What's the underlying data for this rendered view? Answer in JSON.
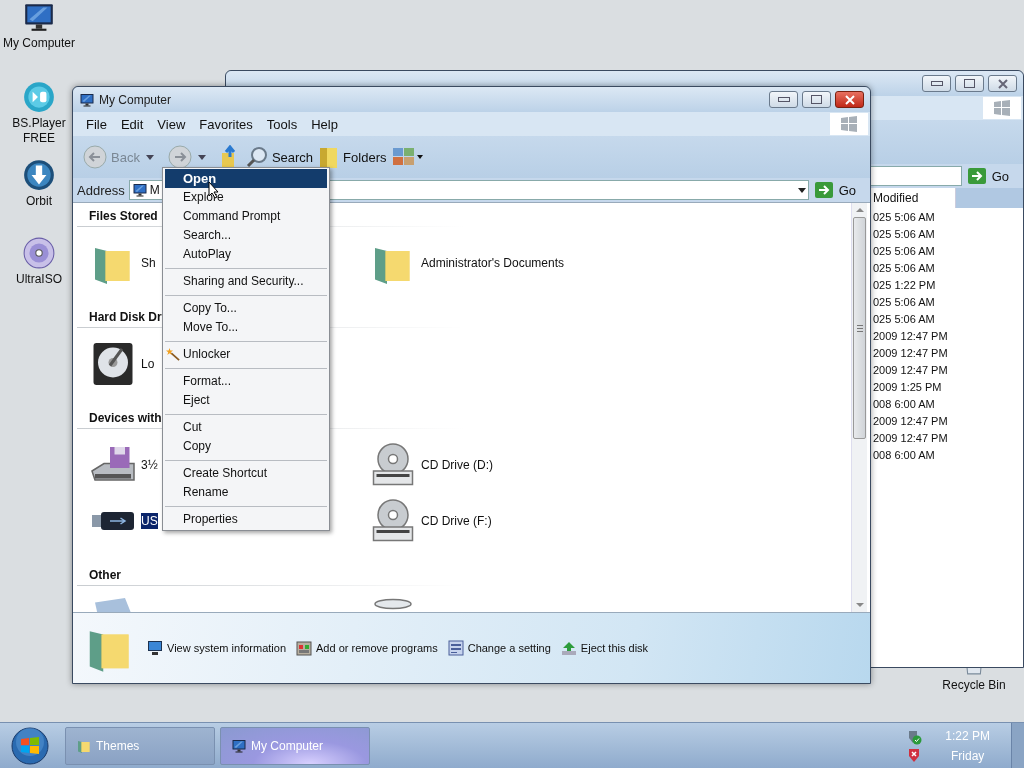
{
  "desktop_icons": [
    {
      "label": "My Computer",
      "kind": "computer"
    },
    {
      "label": "BS.Player\nFREE",
      "kind": "player"
    },
    {
      "label": "Orbit",
      "kind": "orbit"
    },
    {
      "label": "UltraISO",
      "kind": "disc"
    },
    {
      "label": "Recycle Bin",
      "kind": "recycle"
    }
  ],
  "back_window": {
    "go": "Go",
    "column_header": "Modified",
    "rows": [
      "025 5:06 AM",
      "025 5:06 AM",
      "025 5:06 AM",
      "025 5:06 AM",
      "025 1:22 PM",
      "025 5:06 AM",
      "025 5:06 AM",
      "2009 12:47 PM",
      "2009 12:47 PM",
      "2009 12:47 PM",
      "2009 1:25 PM",
      "008 6:00 AM",
      "2009 12:47 PM",
      "2009 12:47 PM",
      "008 6:00 AM"
    ]
  },
  "window": {
    "title": "My Computer",
    "menu": [
      "File",
      "Edit",
      "View",
      "Favorites",
      "Tools",
      "Help"
    ],
    "toolbar": {
      "back": "Back",
      "back_disabled": true,
      "search": "Search",
      "folders": "Folders"
    },
    "address": {
      "label": "Address",
      "value": "M",
      "go": "Go"
    },
    "sections": [
      {
        "title": "Files Stored",
        "items": [
          {
            "label": "Sh",
            "kind": "folder",
            "selected": false
          },
          {
            "label": "Administrator's Documents",
            "kind": "folder",
            "selected": false
          }
        ]
      },
      {
        "title": "Hard Disk Dr",
        "items": [
          {
            "label": "Lo",
            "kind": "harddisk",
            "selected": false
          }
        ]
      },
      {
        "title": "Devices with",
        "items": [
          {
            "label": "3½",
            "kind": "floppy",
            "selected": false
          },
          {
            "label": "CD Drive (D:)",
            "kind": "cd",
            "selected": false
          },
          {
            "label": "US",
            "kind": "usb",
            "selected": true
          },
          {
            "label": "CD Drive (F:)",
            "kind": "cd",
            "selected": false
          }
        ]
      },
      {
        "title": "Other",
        "items": [
          {
            "kind": "network"
          },
          {
            "kind": "bin"
          }
        ]
      }
    ],
    "tasks": [
      {
        "label": "View system information",
        "kind": "monitor"
      },
      {
        "label": "Add or remove programs",
        "kind": "programs"
      },
      {
        "label": "Change a setting",
        "kind": "settings"
      },
      {
        "label": "Eject this disk",
        "kind": "eject"
      }
    ]
  },
  "context_menu": [
    [
      {
        "label": "Open",
        "selected": true,
        "default": true,
        "kind": "plain"
      },
      {
        "label": "Explore",
        "selected": false,
        "default": false,
        "kind": "plain"
      },
      {
        "label": "Command Prompt",
        "selected": false,
        "default": false,
        "kind": "plain"
      },
      {
        "label": "Search...",
        "selected": false,
        "default": false,
        "kind": "plain"
      },
      {
        "label": "AutoPlay",
        "selected": false,
        "default": false,
        "kind": "plain"
      }
    ],
    [
      {
        "label": "Sharing and Security...",
        "selected": false,
        "default": false,
        "kind": "plain"
      }
    ],
    [
      {
        "label": "Copy To...",
        "selected": false,
        "default": false,
        "kind": "plain"
      },
      {
        "label": "Move To...",
        "selected": false,
        "default": false,
        "kind": "plain"
      }
    ],
    [
      {
        "label": "Unlocker",
        "selected": false,
        "default": false,
        "kind": "wand"
      }
    ],
    [
      {
        "label": "Format...",
        "selected": false,
        "default": false,
        "kind": "plain"
      },
      {
        "label": "Eject",
        "selected": false,
        "default": false,
        "kind": "plain"
      }
    ],
    [
      {
        "label": "Cut",
        "selected": false,
        "default": false,
        "kind": "plain"
      },
      {
        "label": "Copy",
        "selected": false,
        "default": false,
        "kind": "plain"
      }
    ],
    [
      {
        "label": "Create Shortcut",
        "selected": false,
        "default": false,
        "kind": "plain"
      },
      {
        "label": "Rename",
        "selected": false,
        "default": false,
        "kind": "plain"
      }
    ],
    [
      {
        "label": "Properties",
        "selected": false,
        "default": false,
        "kind": "plain"
      }
    ]
  ],
  "taskbar": {
    "buttons": [
      {
        "label": "Themes",
        "kind": "folder",
        "selected": false
      },
      {
        "label": "My Computer",
        "kind": "computer",
        "selected": true
      }
    ],
    "time": "1:22 PM",
    "day": "Friday"
  }
}
